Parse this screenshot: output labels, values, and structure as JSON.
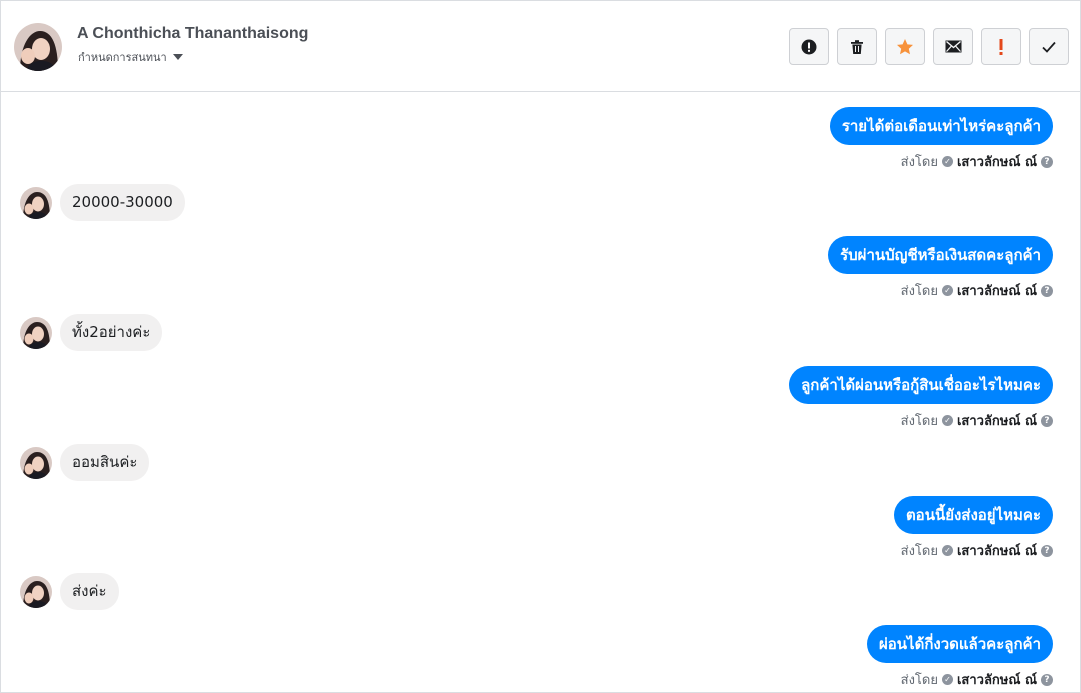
{
  "header": {
    "contact_name": "A Chonthicha Thananthaisong",
    "assign_label": "กำหนดการสนทนา",
    "actions": [
      {
        "name": "report-spam-button",
        "icon": "alert-circle-icon"
      },
      {
        "name": "delete-button",
        "icon": "trash-icon"
      },
      {
        "name": "star-button",
        "icon": "star-icon"
      },
      {
        "name": "mark-unread-button",
        "icon": "envelope-icon"
      },
      {
        "name": "mark-important-button",
        "icon": "exclamation-icon"
      },
      {
        "name": "mark-done-button",
        "icon": "checkmark-icon"
      }
    ]
  },
  "colors": {
    "outgoing_bubble": "#0084ff",
    "incoming_bubble": "#f1f0f0",
    "star": "#f7923b",
    "important": "#e4481b"
  },
  "messages": [
    {
      "direction": "out",
      "text": "รายได้ต่อเดือนเท่าไหร่คะลูกค้า",
      "sent_by_label": "ส่งโดย",
      "agent": "เสาวลักษณ์ ณ์"
    },
    {
      "direction": "in",
      "text": "20000-30000"
    },
    {
      "direction": "out",
      "text": "รับผ่านบัญชีหรือเงินสดคะลูกค้า",
      "sent_by_label": "ส่งโดย",
      "agent": "เสาวลักษณ์ ณ์"
    },
    {
      "direction": "in",
      "text": "ทั้ง2อย่างค่ะ"
    },
    {
      "direction": "out",
      "text": "ลูกค้าได้ผ่อนหรือกู้สินเชื่ออะไรไหมคะ",
      "sent_by_label": "ส่งโดย",
      "agent": "เสาวลักษณ์ ณ์"
    },
    {
      "direction": "in",
      "text": "ออมสินค่ะ"
    },
    {
      "direction": "out",
      "text": "ตอนนี้ยังส่งอยู่ไหมคะ",
      "sent_by_label": "ส่งโดย",
      "agent": "เสาวลักษณ์ ณ์"
    },
    {
      "direction": "in",
      "text": "ส่งค่ะ"
    },
    {
      "direction": "out",
      "text": "ผ่อนได้กี่งวดแล้วคะลูกค้า",
      "sent_by_label": "ส่งโดย",
      "agent": "เสาวลักษณ์ ณ์"
    }
  ]
}
